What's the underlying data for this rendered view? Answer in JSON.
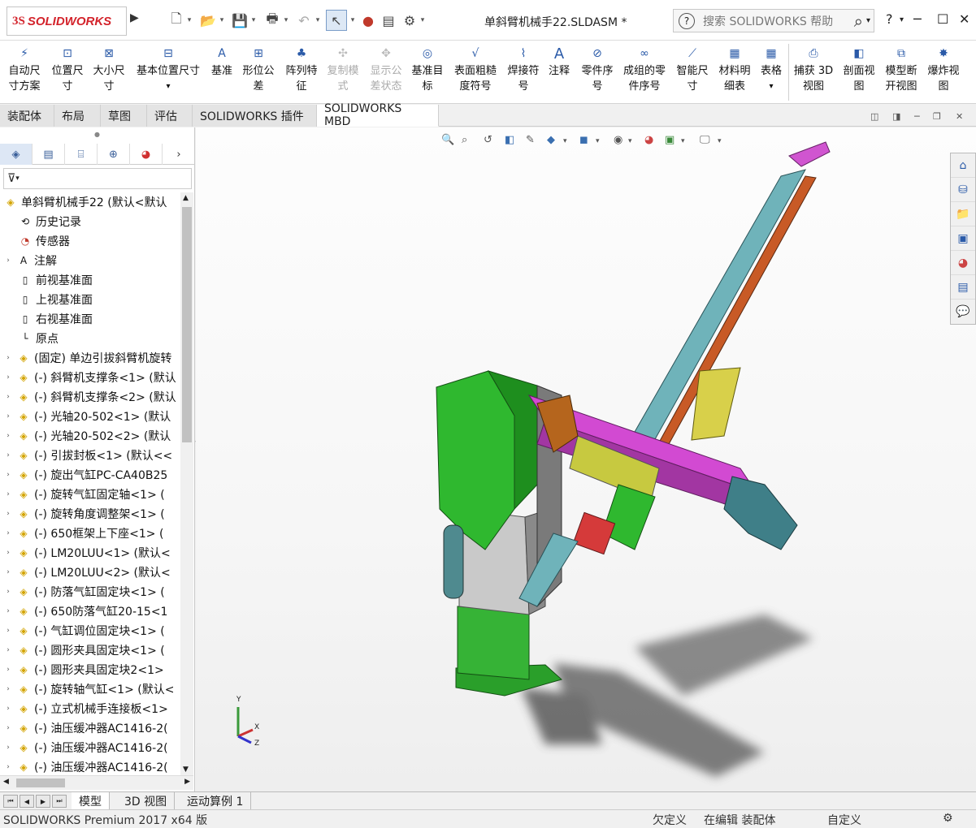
{
  "app": {
    "logo_ds": "3S",
    "logo_text": "SOLIDWORKS",
    "doc_title": "单斜臂机械手22.SLDASM *"
  },
  "search": {
    "placeholder": "搜索 SOLIDWORKS 帮助"
  },
  "commands": [
    {
      "l1": "自动尺",
      "l2": "寸方案"
    },
    {
      "l1": "位置尺",
      "l2": "寸"
    },
    {
      "l1": "大小尺",
      "l2": "寸"
    },
    {
      "l1": "基本位置尺寸",
      "l2": ""
    },
    {
      "l1": "基准",
      "l2": ""
    },
    {
      "l1": "形位公",
      "l2": "差"
    },
    {
      "l1": "阵列特",
      "l2": "征"
    },
    {
      "l1": "复制模",
      "l2": "式"
    },
    {
      "l1": "显示公",
      "l2": "差状态"
    },
    {
      "l1": "基准目",
      "l2": "标"
    },
    {
      "l1": "表面粗糙",
      "l2": "度符号"
    },
    {
      "l1": "焊接符",
      "l2": "号"
    },
    {
      "l1": "注释",
      "l2": ""
    },
    {
      "l1": "零件序",
      "l2": "号"
    },
    {
      "l1": "成组的零",
      "l2": "件序号"
    },
    {
      "l1": "智能尺",
      "l2": "寸"
    },
    {
      "l1": "材料明",
      "l2": "细表"
    },
    {
      "l1": "表格",
      "l2": ""
    },
    {
      "l1": "捕获 3D",
      "l2": "视图"
    },
    {
      "l1": "剖面视",
      "l2": "图"
    },
    {
      "l1": "模型断",
      "l2": "开视图"
    },
    {
      "l1": "爆炸视",
      "l2": "图"
    }
  ],
  "tabs": [
    "装配体",
    "布局",
    "草图",
    "评估",
    "SOLIDWORKS 插件",
    "SOLIDWORKS MBD"
  ],
  "tree": {
    "root": "单斜臂机械手22  (默认<默认",
    "items": [
      "历史记录",
      "传感器",
      "注解",
      "前视基准面",
      "上视基准面",
      "右视基准面",
      "原点",
      "(固定) 单边引拔斜臂机旋转",
      "(-) 斜臂机支撑条<1> (默认",
      "(-) 斜臂机支撑条<2> (默认",
      "(-) 光轴20-502<1> (默认",
      "(-) 光轴20-502<2> (默认",
      "(-) 引拔封板<1> (默认<<",
      "(-) 旋出气缸PC-CA40B25",
      "(-) 旋转气缸固定轴<1> (",
      "(-) 旋转角度调整架<1> (",
      "(-) 650框架上下座<1> (",
      "(-) LM20LUU<1> (默认<",
      "(-) LM20LUU<2> (默认<",
      "(-) 防落气缸固定块<1> (",
      "(-) 650防落气缸20-15<1",
      "(-) 气缸调位固定块<1> (",
      "(-) 圆形夹具固定块<1> (",
      "(-) 圆形夹具固定块2<1>",
      "(-) 旋转轴气缸<1> (默认<",
      "(-) 立式机械手连接板<1>",
      "(-) 油压缓冲器AC1416-2(",
      "(-) 油压缓冲器AC1416-2(",
      "(-) 油压缓冲器AC1416-2("
    ]
  },
  "bottom_tabs": [
    "模型",
    "3D 视图",
    "运动算例 1"
  ],
  "status": {
    "left": "SOLIDWORKS Premium 2017 x64 版",
    "s1": "欠定义",
    "s2": "在编辑 装配体",
    "s3": "自定义"
  },
  "axes": {
    "x": "X",
    "y": "Y",
    "z": "Z"
  },
  "colors": {
    "brand": "#d3232b",
    "green": "#2fb82f",
    "magenta": "#c730c7",
    "steel": "#5f9ea8"
  }
}
